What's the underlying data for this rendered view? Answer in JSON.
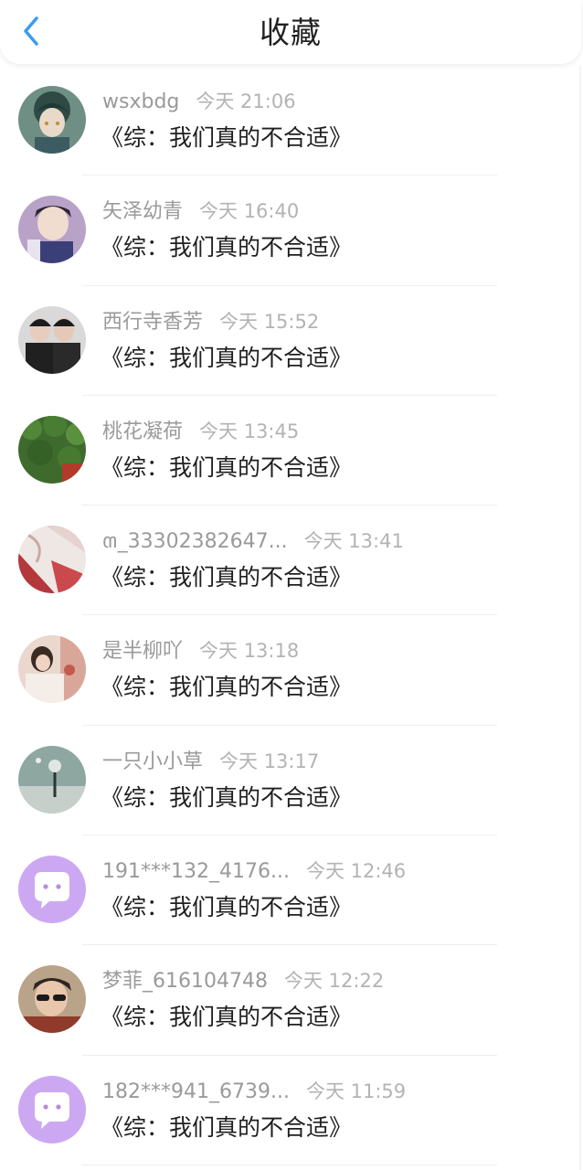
{
  "header": {
    "title": "收藏",
    "back_icon": "chevron-left-icon",
    "accent_color": "#3a9bf0"
  },
  "items": [
    {
      "name": "wsxbdg",
      "time": "今天 21:06",
      "book": "《综：我们真的不合适》",
      "avatar": "photo"
    },
    {
      "name": "矢泽幼青",
      "time": "今天 16:40",
      "book": "《综：我们真的不合适》",
      "avatar": "photo"
    },
    {
      "name": "西行寺香芳",
      "time": "今天 15:52",
      "book": "《综：我们真的不合适》",
      "avatar": "photo"
    },
    {
      "name": "桃花凝荷",
      "time": "今天 13:45",
      "book": "《综：我们真的不合适》",
      "avatar": "photo"
    },
    {
      "name": "ຓ_33302382647...",
      "time": "今天 13:41",
      "book": "《综：我们真的不合适》",
      "avatar": "photo"
    },
    {
      "name": "是半柳吖",
      "time": "今天 13:18",
      "book": "《综：我们真的不合适》",
      "avatar": "photo"
    },
    {
      "name": "一只小小草",
      "time": "今天 13:17",
      "book": "《综：我们真的不合适》",
      "avatar": "photo"
    },
    {
      "name": "191***132_4176...",
      "time": "今天 12:46",
      "book": "《综：我们真的不合适》",
      "avatar": "default-chat-bubble-icon"
    },
    {
      "name": "梦菲_616104748",
      "time": "今天 12:22",
      "book": "《综：我们真的不合适》",
      "avatar": "photo"
    },
    {
      "name": "182***941_6739...",
      "time": "今天 11:59",
      "book": "《综：我们真的不合适》",
      "avatar": "default-chat-bubble-icon"
    }
  ]
}
